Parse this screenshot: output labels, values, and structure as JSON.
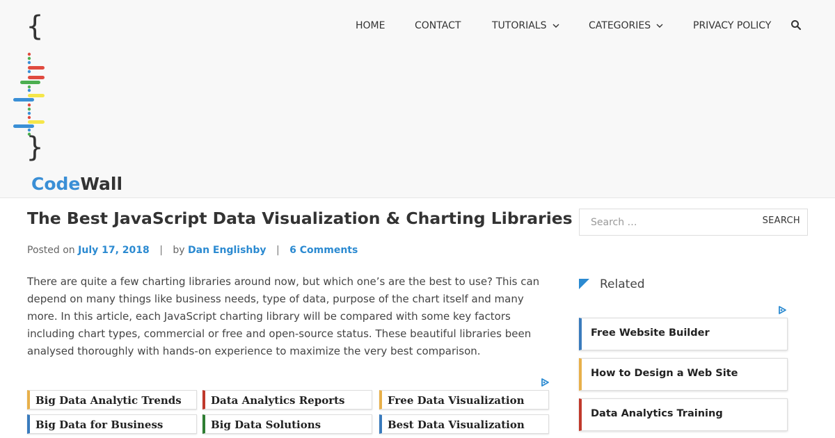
{
  "brand": {
    "brace_open": "{",
    "brace_close": "}",
    "name_part1": "Code",
    "name_part2": "Wall",
    "colors": {
      "blue": "#3a8fd6",
      "red": "#e04a3f",
      "green": "#4caf50",
      "yellow": "#f5e64a"
    }
  },
  "nav": {
    "items": [
      {
        "label": "HOME",
        "has_dropdown": false
      },
      {
        "label": "CONTACT",
        "has_dropdown": false
      },
      {
        "label": "TUTORIALS",
        "has_dropdown": true
      },
      {
        "label": "CATEGORIES",
        "has_dropdown": true
      },
      {
        "label": "PRIVACY POLICY",
        "has_dropdown": false
      }
    ],
    "chevron": "⌄",
    "search_icon": "search-icon"
  },
  "article": {
    "title": "The Best JavaScript Data Visualization & Charting Libraries",
    "meta": {
      "posted_on": "Posted on",
      "date": "July 17, 2018",
      "separator": "|",
      "by": "by",
      "author": "Dan Englishby",
      "comments": "6 Comments"
    },
    "excerpt": "There are quite a few charting libraries around now, but which one’s are the best to use? This can depend on many things like business needs, type of data, purpose of the chart itself and many more. In this article, each JavaScript charting library will be compared with some key factors including chart types, commercial or free and open-source status. These beautiful libraries been analysed thoroughly with hands-on experience to maximize the very best comparison."
  },
  "ads": {
    "links": [
      {
        "label": "Big Data Analytic Trends",
        "accent": "#e8b04a"
      },
      {
        "label": "Data Analytics Reports",
        "accent": "#c0392b"
      },
      {
        "label": "Free Data Visualization",
        "accent": "#e8b04a"
      },
      {
        "label": "Big Data for Business",
        "accent": "#3a7bbd"
      },
      {
        "label": "Big Data Solutions",
        "accent": "#2e7d32"
      },
      {
        "label": "Best Data Visualization",
        "accent": "#3a7bbd"
      }
    ]
  },
  "sidebar": {
    "search": {
      "placeholder": "Search …",
      "button": "SEARCH"
    },
    "related_title": "Related",
    "links": [
      {
        "label": "Free Website Builder",
        "accent": "#3a7bbd"
      },
      {
        "label": "How to Design a Web Site",
        "accent": "#e8b04a"
      },
      {
        "label": "Data Analytics Training",
        "accent": "#c0392b"
      }
    ]
  }
}
